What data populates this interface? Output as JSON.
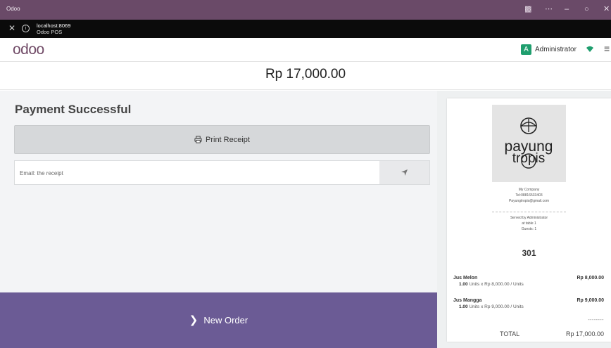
{
  "window": {
    "title": "Odoo",
    "host": "localhost:8069",
    "subtitle": "Odoo POS"
  },
  "navbar": {
    "logo": "odoo",
    "user_initial": "A",
    "user_name": "Administrator"
  },
  "payment": {
    "amount": "Rp 17,000.00",
    "title": "Payment Successful",
    "print_label": "Print Receipt",
    "email_placeholder": "Email: the receipt",
    "new_order_label": "New Order"
  },
  "receipt": {
    "logo_text_top": "payung",
    "logo_text_bottom": "tropis",
    "company": "My Company",
    "tel": "Tel:08816533403",
    "email": "Payungtropis@gmail.com",
    "served_by": "Served by Administrator",
    "table": "at table 1",
    "guests": "Guests: 1",
    "order_number": "301",
    "lines": [
      {
        "name": "Jus Melon",
        "qty": "1.00",
        "detail": "Units x Rp 8,000.00 / Units",
        "price": "Rp 8,000.00"
      },
      {
        "name": "Jus Mangga",
        "qty": "1.00",
        "detail": "Units x Rp 9,000.00 / Units",
        "price": "Rp 9,000.00"
      }
    ],
    "divider": "--------",
    "total_label": "TOTAL",
    "total_value": "Rp 17,000.00"
  },
  "colors": {
    "titlebar": "#6a4a68",
    "new_order": "#6b5b95",
    "avatar": "#1f9e6e",
    "wifi": "#1f9e6e"
  },
  "icons": {
    "close": "close-icon",
    "info": "info-icon",
    "restore": "restore-icon",
    "more": "more-icon",
    "minimize": "minimize-icon",
    "maximize": "maximize-icon",
    "window_close": "window-close-icon",
    "wifi": "wifi-icon",
    "menu": "hamburger-menu-icon",
    "print": "printer-icon",
    "send": "send-icon",
    "chevron": "chevron-right-icon"
  }
}
